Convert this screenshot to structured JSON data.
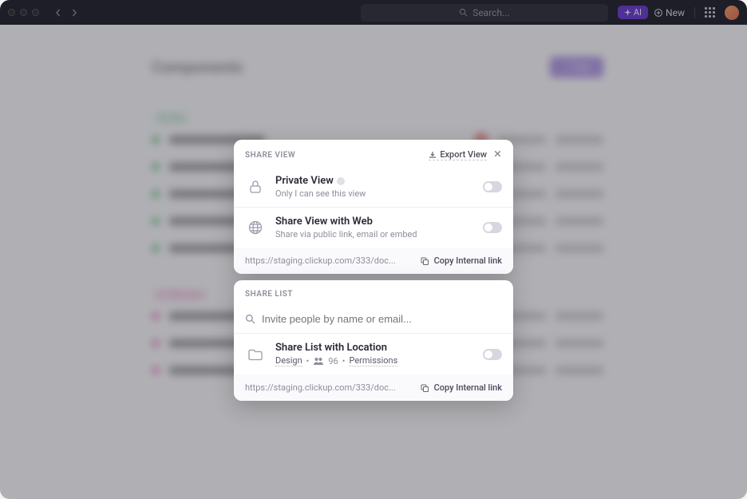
{
  "topbar": {
    "search_placeholder": "Search...",
    "ai_label": "AI",
    "new_label": "New"
  },
  "bg": {
    "title": "Components",
    "group1": "To Do",
    "group2": "In Review"
  },
  "share_view": {
    "header": "SHARE VIEW",
    "export": "Export View",
    "private_title": "Private View",
    "private_sub": "Only I can see this view",
    "web_title": "Share View with Web",
    "web_sub": "Share via public link, email or embed",
    "url": "https://staging.clickup.com/333/doc...",
    "copy": "Copy Internal link"
  },
  "share_list": {
    "header": "SHARE LIST",
    "invite_placeholder": "Invite people by name or email...",
    "location_title": "Share List with Location",
    "meta_design": "Design",
    "meta_count": "96",
    "meta_permissions": "Permissions",
    "url": "https://staging.clickup.com/333/doc...",
    "copy": "Copy Internal link"
  }
}
